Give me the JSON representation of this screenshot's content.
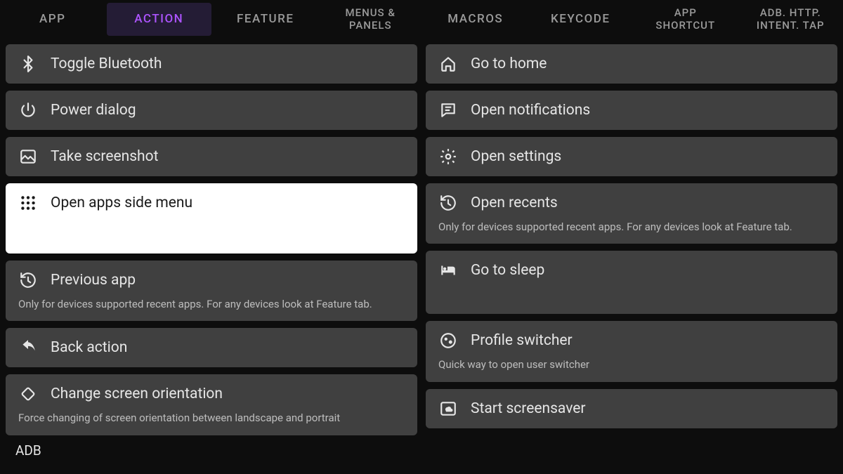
{
  "tabs": [
    {
      "label": "APP"
    },
    {
      "label": "ACTION",
      "active": true
    },
    {
      "label": "FEATURE"
    },
    {
      "label": "MENUS &\nPANELS"
    },
    {
      "label": "MACROS"
    },
    {
      "label": "KEYCODE"
    },
    {
      "label": "APP\nSHORTCUT"
    },
    {
      "label": "ADB. HTTP.\nINTENT. TAP"
    }
  ],
  "left": [
    {
      "icon": "bluetooth",
      "label": "Toggle Bluetooth"
    },
    {
      "icon": "power",
      "label": "Power dialog"
    },
    {
      "icon": "image",
      "label": "Take screenshot"
    },
    {
      "icon": "grid",
      "label": "Open apps side menu",
      "selected": true,
      "tall": true
    },
    {
      "icon": "history",
      "label": "Previous app",
      "sub": "Only for devices supported recent apps. For any devices look at Feature tab."
    },
    {
      "icon": "undo",
      "label": "Back action"
    },
    {
      "icon": "rotate",
      "label": "Change screen orientation",
      "sub": "Force changing of screen orientation between landscape and portrait"
    }
  ],
  "right": [
    {
      "icon": "home",
      "label": "Go to home"
    },
    {
      "icon": "message",
      "label": "Open notifications"
    },
    {
      "icon": "gear",
      "label": "Open settings"
    },
    {
      "icon": "history",
      "label": "Open recents",
      "sub": "Only for devices supported recent apps. For any devices look at Feature tab."
    },
    {
      "icon": "bed",
      "label": "Go to sleep",
      "tall2": true
    },
    {
      "icon": "profile",
      "label": "Profile switcher",
      "sub": "Quick way to open user switcher"
    },
    {
      "icon": "cloud",
      "label": "Start screensaver"
    }
  ],
  "footer": "ADB"
}
